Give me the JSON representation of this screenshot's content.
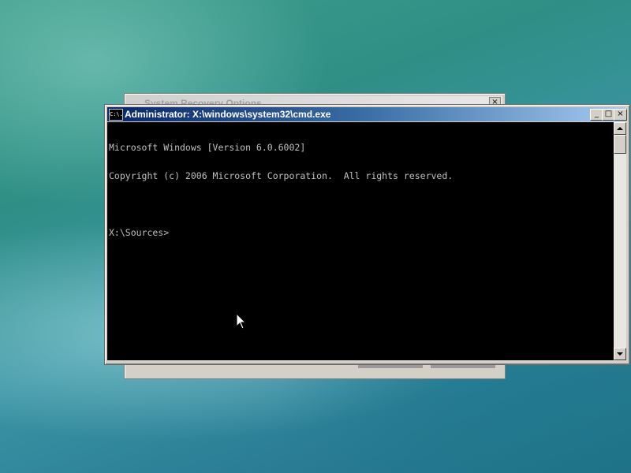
{
  "background_window": {
    "title": "System Recovery Options",
    "close_glyph": "×"
  },
  "cmd_window": {
    "title": "Administrator: X:\\windows\\system32\\cmd.exe",
    "icon_text": "C:\\.",
    "buttons": {
      "minimize": "_",
      "maximize": "□",
      "close": "×"
    },
    "console_lines": [
      "Microsoft Windows [Version 6.0.6002]",
      "Copyright (c) 2006 Microsoft Corporation.  All rights reserved.",
      "",
      "X:\\Sources>"
    ]
  },
  "colors": {
    "titlebar_start": "#0a246a",
    "titlebar_end": "#a6caf0",
    "console_bg": "#000000",
    "console_fg": "#c0c0c0"
  }
}
